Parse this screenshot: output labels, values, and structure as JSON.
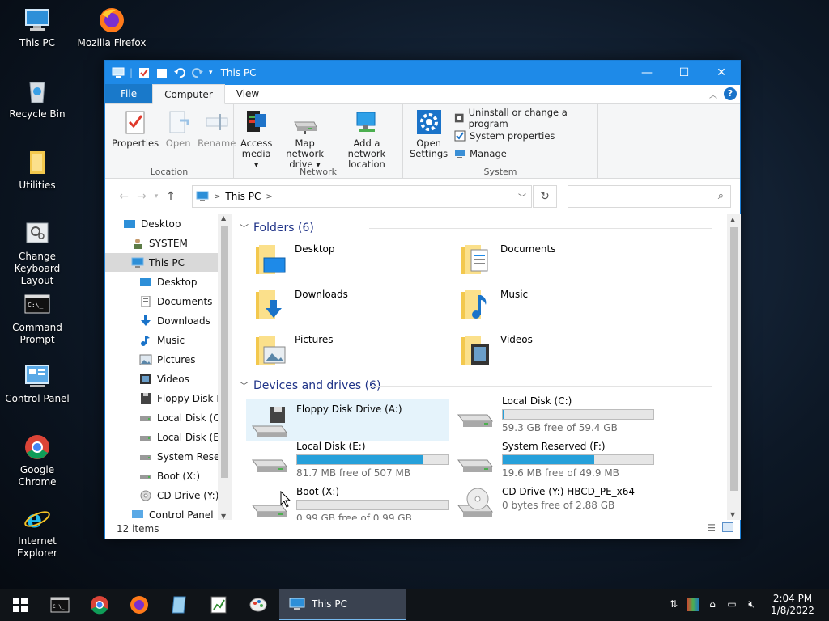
{
  "desktop": {
    "icons": [
      {
        "label": "This PC"
      },
      {
        "label": "Mozilla Firefox"
      },
      {
        "label": "Recycle Bin"
      },
      {
        "label": "Utilities"
      },
      {
        "label": "Change Keyboard Layout"
      },
      {
        "label": "Command Prompt"
      },
      {
        "label": "Control Panel"
      },
      {
        "label": "Google Chrome"
      },
      {
        "label": "Internet Explorer"
      }
    ]
  },
  "window": {
    "title": "This PC",
    "controls": {
      "minimize": "—",
      "maximize": "☐",
      "close": "✕"
    },
    "tabs": {
      "file": "File",
      "computer": "Computer",
      "view": "View"
    },
    "help": "?",
    "ribbon": {
      "location": {
        "label": "Location",
        "properties": "Properties",
        "open": "Open",
        "rename": "Rename"
      },
      "network": {
        "label": "Network",
        "access_media_1": "Access",
        "access_media_2": "media ▾",
        "map_drive_1": "Map network",
        "map_drive_2": "drive ▾",
        "add_location_1": "Add a network",
        "add_location_2": "location"
      },
      "system": {
        "label": "System",
        "open_settings_1": "Open",
        "open_settings_2": "Settings",
        "uninstall": "Uninstall or change a program",
        "system_properties": "System properties",
        "manage": "Manage"
      }
    },
    "address": {
      "path_item": "This PC",
      "search_placeholder": ""
    },
    "nav_pane": [
      {
        "label": "Desktop",
        "indent": 0
      },
      {
        "label": "SYSTEM",
        "indent": 1
      },
      {
        "label": "This PC",
        "indent": 1
      },
      {
        "label": "Desktop",
        "indent": 2
      },
      {
        "label": "Documents",
        "indent": 2
      },
      {
        "label": "Downloads",
        "indent": 2
      },
      {
        "label": "Music",
        "indent": 2
      },
      {
        "label": "Pictures",
        "indent": 2
      },
      {
        "label": "Videos",
        "indent": 2
      },
      {
        "label": "Floppy Disk Dri",
        "indent": 2
      },
      {
        "label": "Local Disk (C:)",
        "indent": 2
      },
      {
        "label": "Local Disk (E:)",
        "indent": 2
      },
      {
        "label": "System Reserve",
        "indent": 2
      },
      {
        "label": "Boot (X:)",
        "indent": 2
      },
      {
        "label": "CD Drive (Y:) H",
        "indent": 2
      },
      {
        "label": "Control Panel",
        "indent": 1
      }
    ],
    "folders_header": "Folders (6)",
    "folders": [
      {
        "name": "Desktop"
      },
      {
        "name": "Documents"
      },
      {
        "name": "Downloads"
      },
      {
        "name": "Music"
      },
      {
        "name": "Pictures"
      },
      {
        "name": "Videos"
      }
    ],
    "drives_header": "Devices and drives (6)",
    "drives": [
      {
        "name": "Floppy Disk Drive (A:)",
        "free": "",
        "used_fraction": null
      },
      {
        "name": "Local Disk (C:)",
        "free": "59.3 GB free of 59.4 GB",
        "used_fraction": 0.002
      },
      {
        "name": "Local Disk (E:)",
        "free": "81.7 MB free of 507 MB",
        "used_fraction": 0.84
      },
      {
        "name": "System Reserved (F:)",
        "free": "19.6 MB free of 49.9 MB",
        "used_fraction": 0.61
      },
      {
        "name": "Boot (X:)",
        "free": "0.99 GB free of 0.99 GB",
        "used_fraction": 0.0
      },
      {
        "name": "CD Drive (Y:) HBCD_PE_x64",
        "free": "0 bytes free of 2.88 GB",
        "used_fraction": null
      }
    ],
    "status": "12 items"
  },
  "taskbar": {
    "active_window": "This PC",
    "time": "2:04 PM",
    "date": "1/8/2022"
  }
}
